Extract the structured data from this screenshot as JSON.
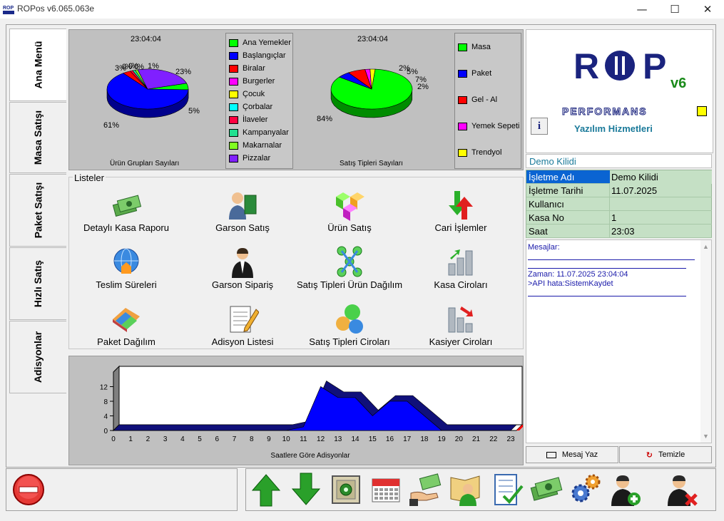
{
  "window": {
    "title": "ROPos v6.065.063e",
    "minimize_icon": "minimize-icon",
    "maximize_icon": "maximize-icon",
    "close_icon": "close-icon"
  },
  "tabs": [
    "Ana Menü",
    "Masa Satışı",
    "Paket Satışı",
    "Hızlı Satış",
    "Adisyonlar"
  ],
  "charts_top": {
    "left_time": "23:04:04",
    "left_caption": "Ürün Grupları Sayıları",
    "right_time": "23:04:04",
    "right_caption": "Satış Tipleri Sayıları"
  },
  "colors": {
    "green": "#00ff00",
    "blue": "#0000ff",
    "red": "#ff0000",
    "magenta": "#ff00ff",
    "yellow": "#ffff00",
    "cyan": "#00ffff",
    "crimson": "#ff0040",
    "seagreen": "#20e090",
    "lime": "#80ff20",
    "purple": "#8020ff",
    "info_bg": "#c5e0c5",
    "msg_text": "#1a1aaa"
  },
  "chart_data": [
    {
      "type": "pie",
      "title": "Ürün Grupları Sayıları",
      "subtitle": "23:04:04",
      "categories": [
        "Ana Yemekler",
        "Başlangıçlar",
        "Biralar",
        "Burgerler",
        "Çocuk",
        "Çorbalar",
        "İlaveler",
        "Kampanyalar",
        "Makarnalar",
        "Pizzalar"
      ],
      "values": [
        5,
        61,
        3,
        0,
        0,
        0,
        1,
        1,
        1,
        23
      ],
      "data_labels": [
        "5%",
        "61%",
        "3%",
        "0%",
        "0%",
        "0%",
        "1%",
        "1%",
        "1%",
        "23%"
      ],
      "legend": "right"
    },
    {
      "type": "pie",
      "title": "Satış Tipleri Sayıları",
      "subtitle": "23:04:04",
      "categories": [
        "Masa",
        "Paket",
        "Gel - Al",
        "Yemek Sepeti",
        "Trendyol"
      ],
      "values": [
        84,
        5,
        7,
        2,
        2
      ],
      "data_labels": [
        "84%",
        "5%",
        "7%",
        "2%",
        "2%"
      ],
      "legend": "right"
    },
    {
      "type": "area",
      "title": "Saatlere Göre Adisyonlar",
      "x": [
        0,
        1,
        2,
        3,
        4,
        5,
        6,
        7,
        8,
        9,
        10,
        11,
        12,
        13,
        14,
        15,
        16,
        17,
        18,
        19,
        20,
        21,
        22,
        23
      ],
      "values": [
        0,
        0,
        0,
        0,
        0,
        0,
        0,
        0,
        0,
        0,
        0,
        1,
        12,
        9,
        9,
        4,
        8,
        8,
        4,
        0,
        0,
        0,
        0,
        0
      ],
      "yticks": [
        0,
        4,
        8,
        12
      ],
      "ylim": [
        0,
        16
      ]
    }
  ],
  "listeler": {
    "title": "Listeler",
    "items": [
      {
        "label": "Detaylı Kasa Raporu",
        "icon": "money-stack-icon"
      },
      {
        "label": "Garson Satış",
        "icon": "waiter-book-icon"
      },
      {
        "label": "Ürün Satış",
        "icon": "cubes-icon"
      },
      {
        "label": "Cari İşlemler",
        "icon": "arrows-exchange-icon"
      },
      {
        "label": "Teslim Süreleri",
        "icon": "globe-delivery-icon"
      },
      {
        "label": "Garson Sipariş",
        "icon": "waiter-icon"
      },
      {
        "label": "Satış Tipleri Ürün Dağılım",
        "icon": "molecule-icon"
      },
      {
        "label": "Kasa Ciroları",
        "icon": "bar-chart-icon"
      },
      {
        "label": "Paket Dağılım",
        "icon": "package-icon"
      },
      {
        "label": "Adisyon Listesi",
        "icon": "notepad-icon"
      },
      {
        "label": "Satış Tipleri Ciroları",
        "icon": "bubbles-icon"
      },
      {
        "label": "Kasiyer Ciroları",
        "icon": "bar-chart-arrow-icon"
      }
    ]
  },
  "logo": {
    "r": "R",
    "p": "P",
    "version": "v6",
    "performans": "PERFORMANS",
    "tagline": "Yazılım Hizmetleri",
    "info_btn": "i"
  },
  "info": {
    "header": "Demo Kilidi",
    "rows": [
      {
        "key": "İşletme Adı",
        "value": "Demo Kilidi"
      },
      {
        "key": "İşletme Tarihi",
        "value": "11.07.2025"
      },
      {
        "key": "Kullanıcı",
        "value": ""
      },
      {
        "key": "Kasa No",
        "value": "1"
      },
      {
        "key": "Saat",
        "value": "23:03"
      }
    ]
  },
  "messages": {
    "title": "Mesajlar:",
    "line1": "Zaman: 11.07.2025 23:04:04",
    "line2": ">API hata:SistemKaydet",
    "write_btn": "Mesaj Yaz",
    "clear_btn": "Temizle"
  },
  "toolbar": {
    "exit": "exit-icon",
    "buttons": [
      "arrow-up-icon",
      "arrow-down-icon",
      "safe-icon",
      "calendar-icon",
      "payment-icon",
      "customer-book-icon",
      "checklist-icon",
      "money-icon",
      "settings-gears-icon",
      "add-user-icon",
      "remove-user-icon"
    ]
  }
}
